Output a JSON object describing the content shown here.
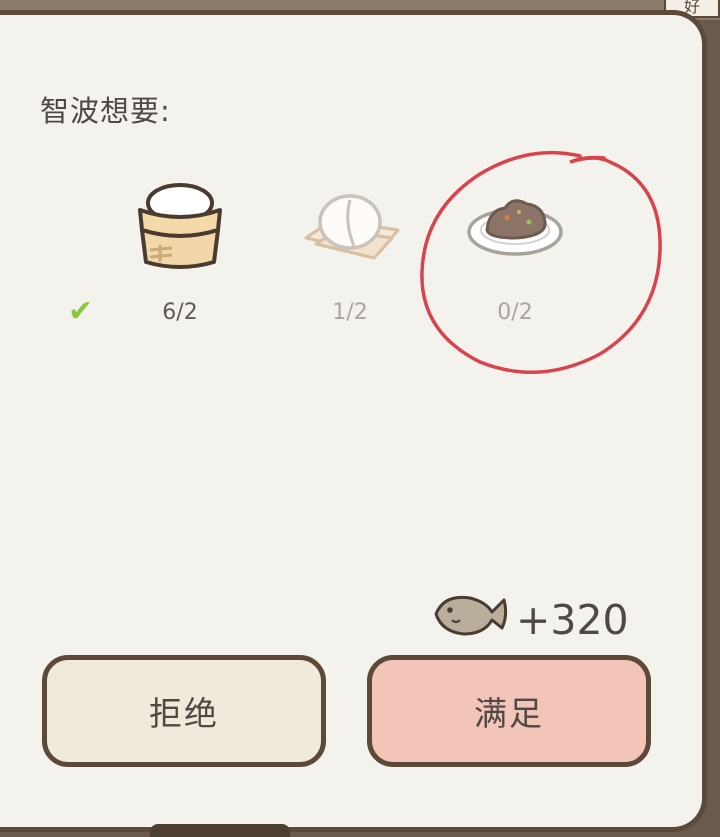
{
  "corner_tab": {
    "label": "好"
  },
  "dialog": {
    "title": "智波想要:",
    "items": [
      {
        "name": "steamed-buns-basket",
        "count": "6/2",
        "complete": true,
        "check": "✔"
      },
      {
        "name": "mochi-dumpling",
        "count": "1/2",
        "complete": false
      },
      {
        "name": "meat-dish",
        "count": "0/2",
        "complete": false
      }
    ],
    "reward": {
      "icon": "fish-icon",
      "amount": "+320"
    },
    "buttons": {
      "refuse": "拒绝",
      "satisfy": "满足"
    }
  },
  "annotation": {
    "shape": "hand-drawn-circle",
    "color": "#d9434d"
  },
  "colors": {
    "panel_bg": "#f4f2ec",
    "border": "#5c4938",
    "refuse_bg": "#efeadb",
    "satisfy_bg": "#f3c4b8",
    "check": "#8cc63f"
  }
}
